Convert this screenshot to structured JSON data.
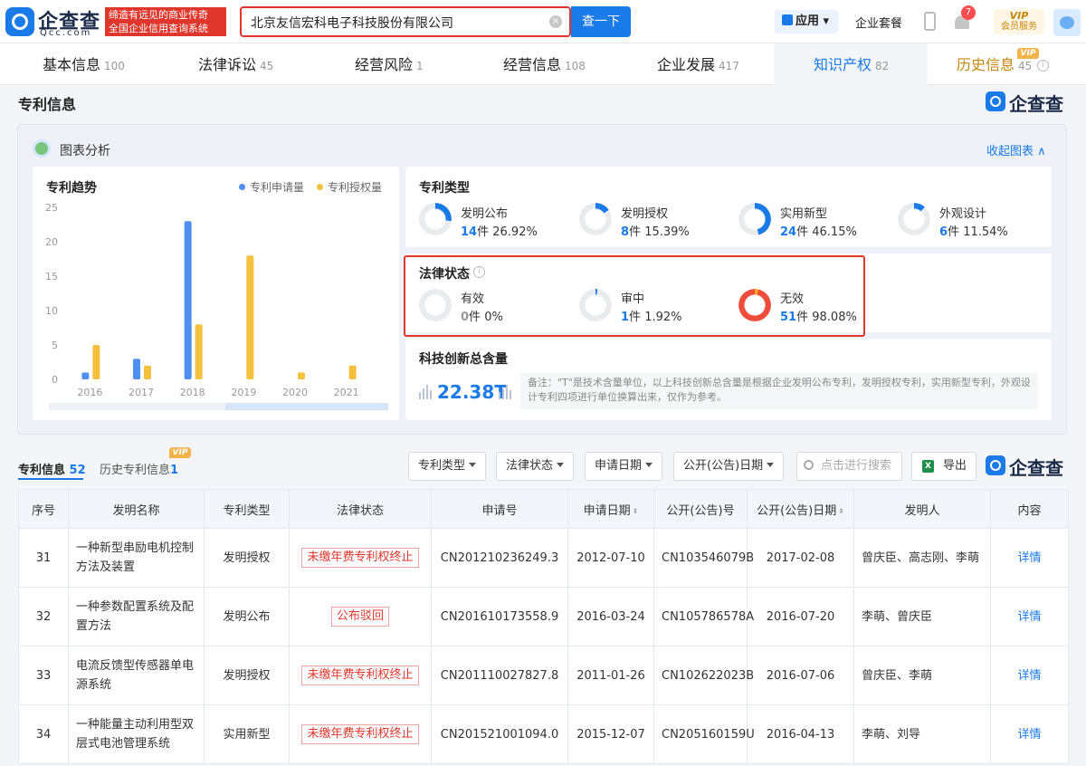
{
  "header": {
    "logo_text": "企查查",
    "logo_domain": "Qcc.com",
    "slogan_line1": "缔造有远见的商业传奇",
    "slogan_line2": "全国企业信用查询系统",
    "search_value": "北京友信宏科电子科技股份有限公司",
    "search_button": "查一下",
    "app_menu": "应用",
    "suite": "企业套餐",
    "notification_count": "7",
    "vip_label": "VIP",
    "vip_service": "会员服务"
  },
  "tabs": [
    {
      "label": "基本信息",
      "count": "100"
    },
    {
      "label": "法律诉讼",
      "count": "45"
    },
    {
      "label": "经营风险",
      "count": "1"
    },
    {
      "label": "经营信息",
      "count": "108"
    },
    {
      "label": "企业发展",
      "count": "417"
    },
    {
      "label": "知识产权",
      "count": "82"
    },
    {
      "label": "历史信息",
      "count": "45",
      "badge": "VIP"
    }
  ],
  "section": {
    "title": "专利信息",
    "brand": "企查查",
    "chart_panel_title": "图表分析",
    "collapse_label": "收起图表"
  },
  "trend": {
    "title": "专利趋势",
    "legend_apply": "专利申请量",
    "legend_grant": "专利授权量"
  },
  "chart_data": {
    "type": "bar",
    "title": "专利趋势",
    "categories": [
      "2016",
      "2017",
      "2018",
      "2019",
      "2020",
      "2021"
    ],
    "series": [
      {
        "name": "专利申请量",
        "values": [
          1,
          3,
          23,
          0,
          0,
          0
        ],
        "color": "#4f8ff0"
      },
      {
        "name": "专利授权量",
        "values": [
          5,
          2,
          8,
          18,
          1,
          2
        ],
        "color": "#f5c03b"
      }
    ],
    "yticks": [
      "25",
      "20",
      "15",
      "10",
      "5",
      "0"
    ],
    "ylim": [
      0,
      25
    ],
    "grid": false,
    "legend": "top-right"
  },
  "patent_types": {
    "title": "专利类型",
    "items": [
      {
        "name": "发明公布",
        "count": "14",
        "unit": "件",
        "pct": "26.92%",
        "fraction": 0.2692
      },
      {
        "name": "发明授权",
        "count": "8",
        "unit": "件",
        "pct": "15.39%",
        "fraction": 0.1539
      },
      {
        "name": "实用新型",
        "count": "24",
        "unit": "件",
        "pct": "46.15%",
        "fraction": 0.4615
      },
      {
        "name": "外观设计",
        "count": "6",
        "unit": "件",
        "pct": "11.54%",
        "fraction": 0.1154
      }
    ]
  },
  "legal_status": {
    "title": "法律状态",
    "items": [
      {
        "name": "有效",
        "count": "0",
        "unit": "件",
        "pct": "0%",
        "fraction": 0
      },
      {
        "name": "审中",
        "count": "1",
        "unit": "件",
        "pct": "1.92%",
        "fraction": 0.0192
      },
      {
        "name": "无效",
        "count": "51",
        "unit": "件",
        "pct": "98.08%",
        "fraction": 0.9808
      }
    ]
  },
  "innovation": {
    "title": "科技创新总含量",
    "value": "22.38T",
    "note": "备注：\"T\"是技术含量单位，以上科技创新总含量是根据企业发明公布专利，发明授权专利，实用新型专利，外观设计专利四项进行单位换算出来，仅作为参考。"
  },
  "list_toolbar": {
    "tab_current": "专利信息",
    "tab_current_count": "52",
    "tab_history": "历史专利信息",
    "tab_history_count": "1",
    "tab_history_badge": "VIP",
    "filter_type": "专利类型",
    "filter_status": "法律状态",
    "filter_apply_date": "申请日期",
    "filter_pub_date": "公开(公告)日期",
    "search_placeholder": "点击进行搜索",
    "export_label": "导出",
    "brand": "企查查"
  },
  "table": {
    "headers": [
      "序号",
      "发明名称",
      "专利类型",
      "法律状态",
      "申请号",
      "申请日期",
      "公开(公告)号",
      "公开(公告)日期",
      "发明人",
      "内容"
    ],
    "rows": [
      {
        "no": "31",
        "name": "一种新型串励电机控制方法及装置",
        "type": "发明授权",
        "status": "未缴年费专利权终止",
        "app_no": "CN201210236249.3",
        "app_date": "2012-07-10",
        "pub_no": "CN103546079B",
        "pub_date": "2017-02-08",
        "inventor": "曾庆臣、高志刚、李萌",
        "action": "详情"
      },
      {
        "no": "32",
        "name": "一种参数配置系统及配置方法",
        "type": "发明公布",
        "status": "公布驳回",
        "app_no": "CN201610173558.9",
        "app_date": "2016-03-24",
        "pub_no": "CN105786578A",
        "pub_date": "2016-07-20",
        "inventor": "李萌、曾庆臣",
        "action": "详情"
      },
      {
        "no": "33",
        "name": "电流反馈型传感器单电源系统",
        "type": "发明授权",
        "status": "未缴年费专利权终止",
        "app_no": "CN201110027827.8",
        "app_date": "2011-01-26",
        "pub_no": "CN102622023B",
        "pub_date": "2016-07-06",
        "inventor": "曾庆臣、李萌",
        "action": "详情"
      },
      {
        "no": "34",
        "name": "一种能量主动利用型双层式电池管理系统",
        "type": "实用新型",
        "status": "未缴年费专利权终止",
        "app_no": "CN201521001094.0",
        "app_date": "2015-12-07",
        "pub_no": "CN205160159U",
        "pub_date": "2016-04-13",
        "inventor": "李萌、刘导",
        "action": "详情"
      }
    ]
  }
}
